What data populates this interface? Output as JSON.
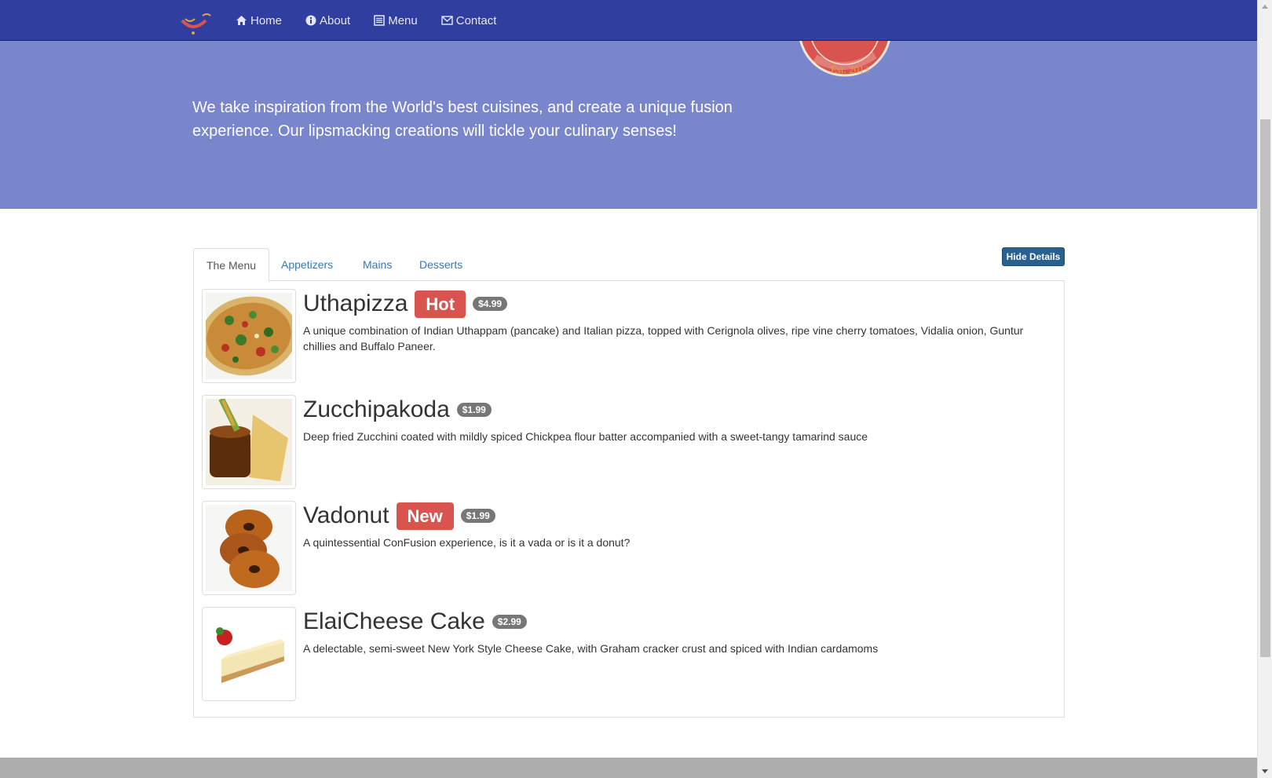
{
  "nav": {
    "items": [
      {
        "label": "Home",
        "icon": "home-icon"
      },
      {
        "label": "About",
        "icon": "info-icon"
      },
      {
        "label": "Menu",
        "icon": "list-icon"
      },
      {
        "label": "Contact",
        "icon": "envelope-icon"
      }
    ]
  },
  "jumbotron": {
    "text": "We take inspiration from the World's best cuisines, and create a unique fusion experience. Our lipsmacking creations will tickle your culinary senses!"
  },
  "tabs": [
    {
      "label": "The Menu",
      "active": true
    },
    {
      "label": "Appetizers",
      "active": false
    },
    {
      "label": "Mains",
      "active": false
    },
    {
      "label": "Desserts",
      "active": false
    }
  ],
  "hide_button": "Hide Details",
  "dishes": [
    {
      "name": "Uthapizza",
      "label": "Hot",
      "price": "$4.99",
      "description": "A unique combination of Indian Uthappam (pancake) and Italian pizza, topped with Cerignola olives, ripe vine cherry tomatoes, Vidalia onion, Guntur chillies and Buffalo Paneer."
    },
    {
      "name": "Zucchipakoda",
      "label": "",
      "price": "$1.99",
      "description": "Deep fried Zucchini coated with mildly spiced Chickpea flour batter accompanied with a sweet-tangy tamarind sauce"
    },
    {
      "name": "Vadonut",
      "label": "New",
      "price": "$1.99",
      "description": "A quintessential ConFusion experience, is it a vada or is it a donut?"
    },
    {
      "name": "ElaiCheese Cake",
      "label": "",
      "price": "$2.99",
      "description": "A delectable, semi-sweet New York Style Cheese Cake, with Graham cracker crust and spiced with Indian cardamoms"
    }
  ],
  "colors": {
    "navbar": "#303F9F",
    "jumbotron": "#7986CB",
    "label_danger": "#d9534f",
    "badge": "#777777",
    "primary_button": "#286090"
  }
}
